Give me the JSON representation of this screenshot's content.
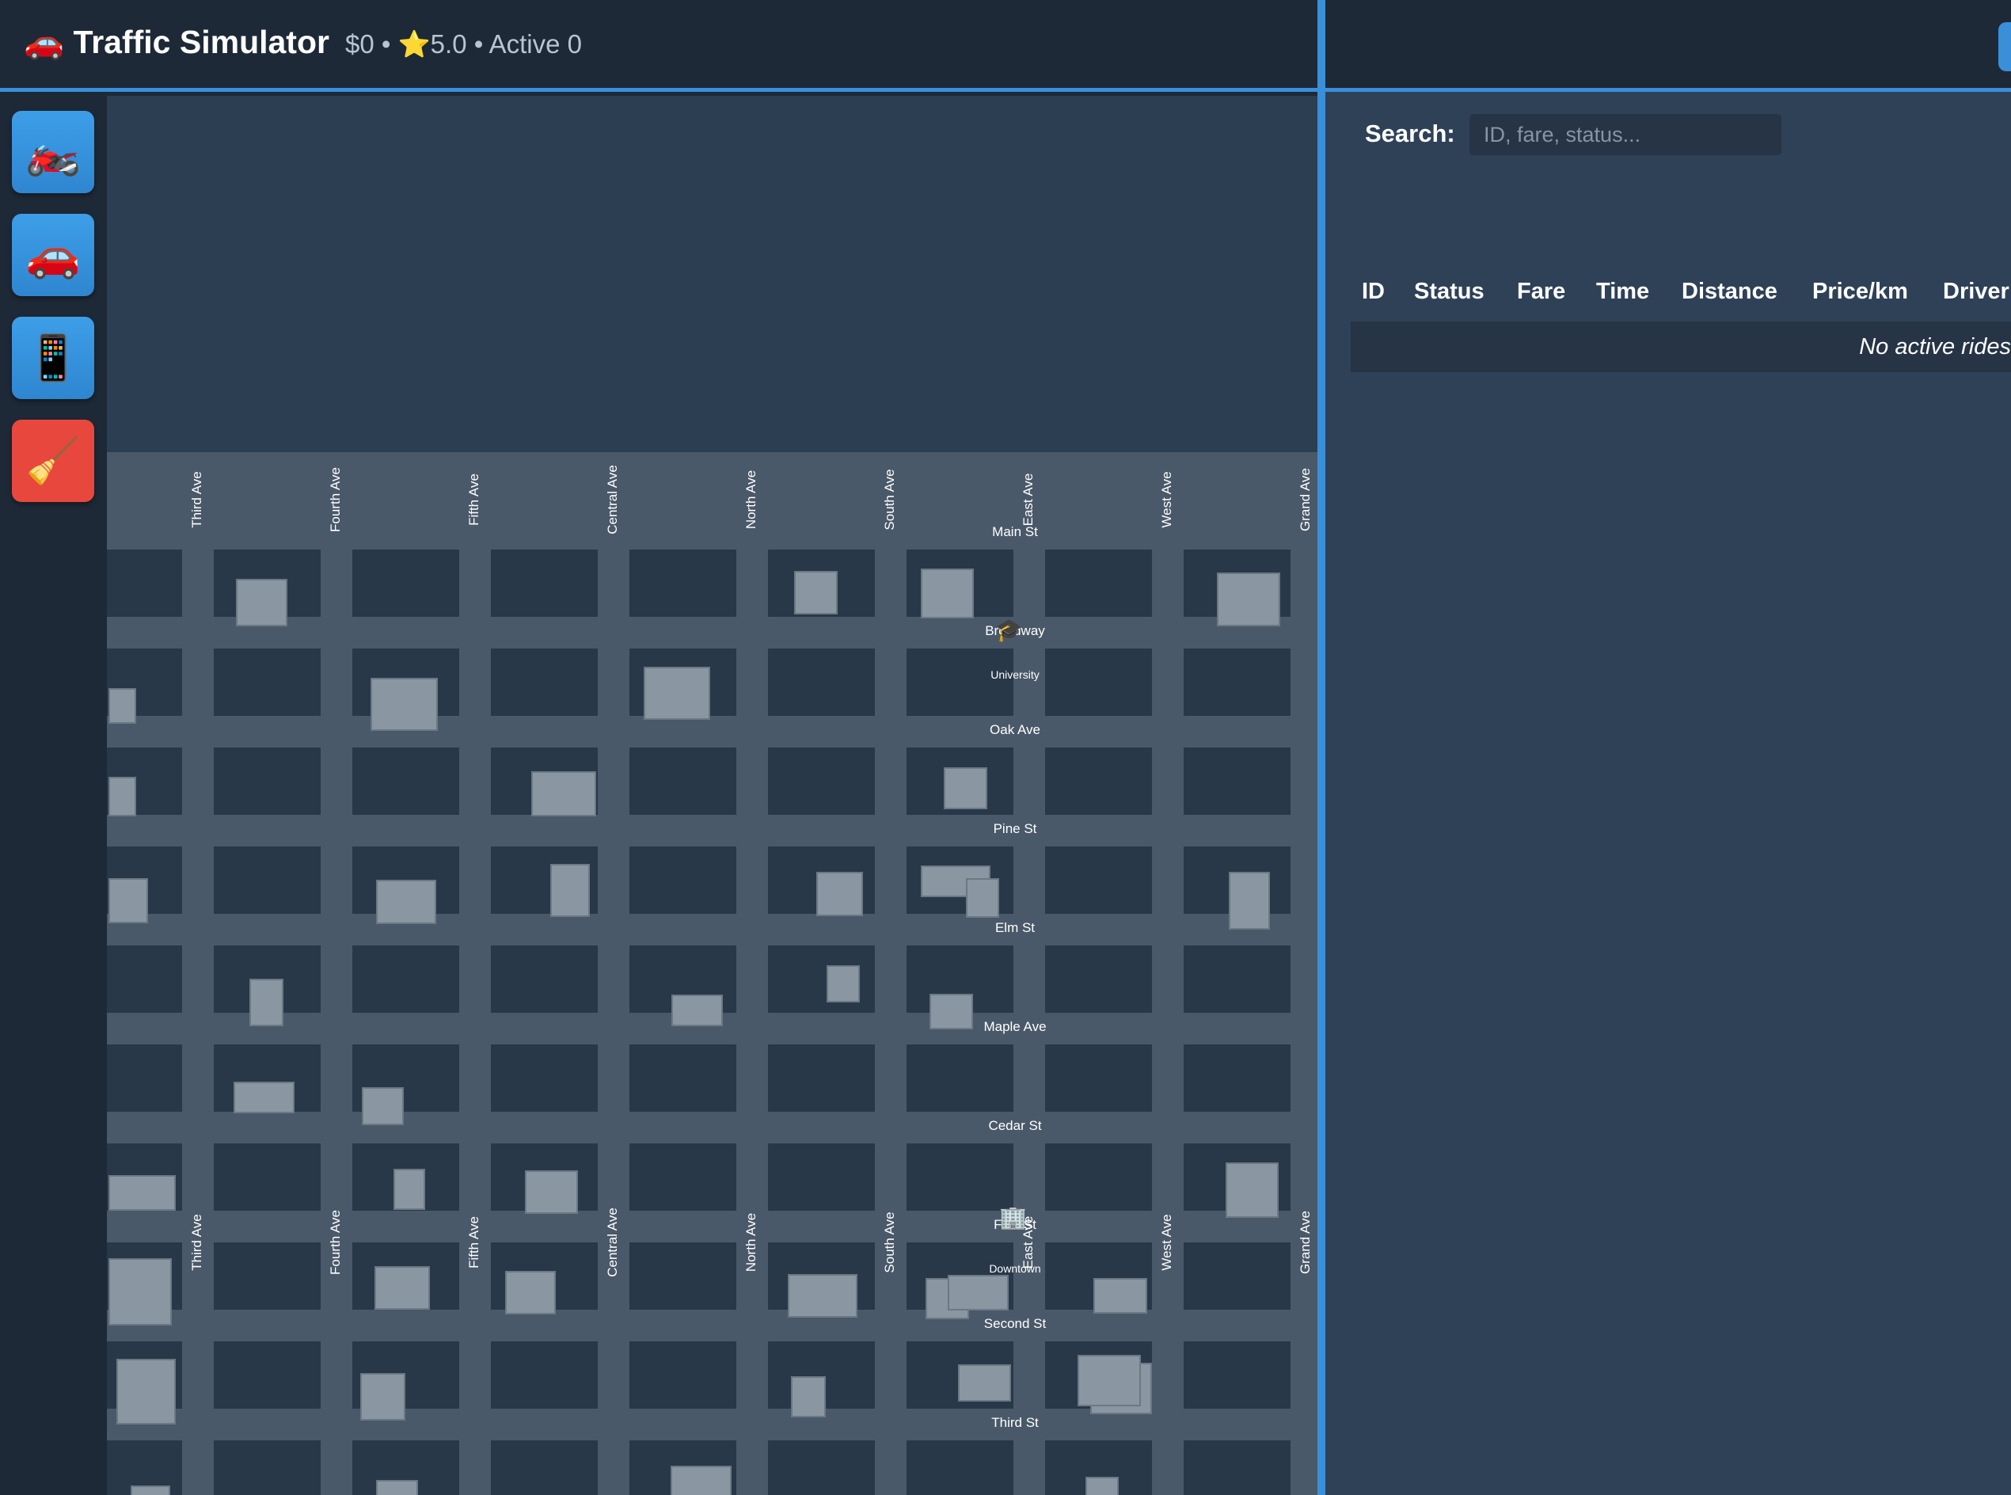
{
  "header": {
    "title": "🚗 Traffic Simulator",
    "stats": "$0 • ⭐5.0 • Active 0"
  },
  "tools": [
    {
      "icon": "motorcycle-icon",
      "glyph": "🏍️"
    },
    {
      "icon": "car-icon",
      "glyph": "🚗"
    },
    {
      "icon": "phone-icon",
      "glyph": "📱"
    },
    {
      "icon": "broom-icon",
      "glyph": "🧹"
    }
  ],
  "map": {
    "streets": [
      "Main St",
      "Broadway",
      "Oak Ave",
      "Pine St",
      "Elm St",
      "Maple Ave",
      "Cedar St",
      "First St",
      "Second St",
      "Third St"
    ],
    "avenues": [
      "Third Ave",
      "Fourth Ave",
      "Fifth Ave",
      "Central Ave",
      "North Ave",
      "South Ave",
      "East Ave",
      "West Ave",
      "Grand Ave"
    ],
    "landmarks": [
      {
        "name": "University",
        "icon": "graduation-cap-icon",
        "glyph": "🎓"
      },
      {
        "name": "Downtown",
        "icon": "office-building-icon",
        "glyph": "🏢"
      }
    ]
  },
  "rides": {
    "search_label": "Search:",
    "search_placeholder": "ID, fare, status...",
    "search_value": "",
    "columns": [
      "ID",
      "Status",
      "Fare",
      "Time",
      "Distance",
      "Price/km",
      "Driver"
    ],
    "empty_text": "No active rides"
  },
  "colors": {
    "accent": "#3a8fd9",
    "panel": "#2f4157",
    "map_bg": "#2c3e51",
    "road": "#4a5969",
    "block": "#283848",
    "building": "#8a97a3",
    "danger": "#e8473e"
  }
}
